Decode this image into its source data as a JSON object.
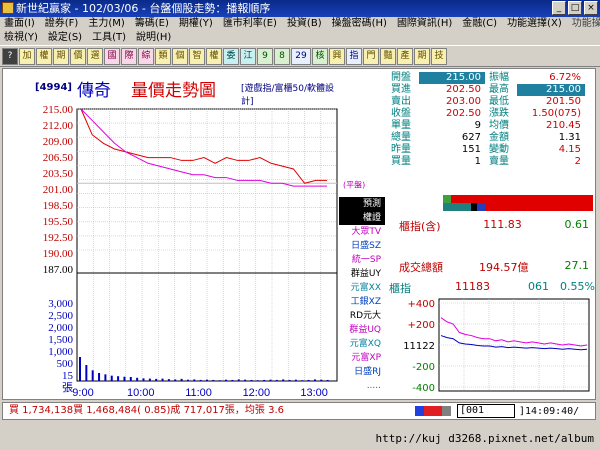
{
  "window": {
    "title": "新世紀贏家 - 102/03/06 - 台盤個股走勢：播報順序"
  },
  "menu_row1": [
    "畫面(I)",
    "證券(F)",
    "主力(M)",
    "籌碼(E)",
    "期權(Y)",
    "匯市利率(E)",
    "投資(B)",
    "操盤密碼(H)",
    "國際資訊(H)",
    "金融(C)",
    "功能選擇(X)"
  ],
  "menu_row1_right": "功能操作",
  "menu_row2": [
    "檢視(Y)",
    "設定(S)",
    "工具(T)",
    "說明(H)"
  ],
  "toolbar": [
    "?",
    "加",
    "權",
    "期",
    "價",
    "選",
    "國",
    "際",
    "綜",
    "類",
    "個",
    "智",
    "權",
    "委",
    "江",
    "9",
    "8",
    "29",
    "核",
    "興",
    "指",
    "門",
    "豔",
    "產",
    "期",
    "技"
  ],
  "header": {
    "code": "[4994]",
    "name": "傳奇",
    "title": "量價走勢圖",
    "setting": "[遊戲指/富櫃50/軟體設計]"
  },
  "side_labels": [
    "預測",
    "權證",
    "大眾TV",
    "日盛SZ",
    "統一SP",
    "群益UY",
    "元富XX",
    "工銀XZ",
    "RD元大",
    "群益UQ",
    "元富XQ",
    "元富XP",
    "日盛RJ",
    "....."
  ],
  "price_labels": [
    "215.00",
    "212.00",
    "209.00",
    "206.50",
    "203.50",
    "201.00",
    "198.50",
    "195.50",
    "192.50",
    "190.00",
    "187.00"
  ],
  "volume_labels": [
    "3,000",
    "2,500",
    "2,000",
    "1,500",
    "1,000",
    "500",
    "15",
    "張"
  ],
  "time_labels": [
    "9:00",
    "10:00",
    "11:00",
    "12:00",
    "13:00"
  ],
  "ref_label": "(平盤)",
  "quotes": [
    {
      "l1": "開盤",
      "v1": "215.00",
      "l2": "振幅",
      "v2": "6.72%"
    },
    {
      "l1": "買進",
      "v1": "202.50",
      "l2": "最高",
      "v2": "215.00"
    },
    {
      "l1": "賣出",
      "v1": "203.00",
      "l2": "最低",
      "v2": "201.50"
    },
    {
      "l1": "收盤",
      "v1": "202.50",
      "l2": "漲跌",
      "v2": "1.50(075)"
    },
    {
      "l1": "單量",
      "v1": "9",
      "l2": "均價",
      "v2": "210.45"
    },
    {
      "l1": "總量",
      "v1": "627",
      "l2": "金額",
      "v2": "1.31"
    },
    {
      "l1": "昨量",
      "v1": "151",
      "l2": "變動",
      "v2": "4.15"
    },
    {
      "l1": "買量",
      "v1": "1",
      "l2": "賣量",
      "v2": "2"
    }
  ],
  "index_line": {
    "label": "櫃指(含)",
    "v1": "111.83",
    "v2": "0.61"
  },
  "total_line": {
    "label": "成交總額",
    "v1": "194.57億",
    "v2": "27.1"
  },
  "otc_head": {
    "label": "櫃指",
    "v1": "11183",
    "v2": "061",
    "v3": "0.55%"
  },
  "mini_labels": [
    "+400",
    "+200",
    "11122",
    "-200",
    "-400"
  ],
  "status": {
    "text": "買 1,734,138買 1,468,484( 0.85)成 717,017張，均張 3.6",
    "code": "[001",
    "time": "]14:09:40/"
  },
  "url": "http://kuj d3268.pixnet.net/album",
  "chart_data": {
    "type": "line",
    "price": {
      "ylim": [
        187.0,
        215.0
      ],
      "reference": 202.0,
      "x": [
        "9:00",
        "9:05",
        "9:10",
        "9:15",
        "9:20",
        "9:30",
        "9:45",
        "10:00",
        "10:15",
        "10:30",
        "10:45",
        "11:00",
        "11:15",
        "11:30",
        "11:45",
        "12:00",
        "12:15",
        "12:30",
        "12:45",
        "13:00",
        "13:10",
        "13:20",
        "13:30"
      ],
      "series": [
        {
          "values": [
            215.0,
            210.5,
            209.0,
            208.0,
            207.5,
            207.0,
            206.5,
            206.5,
            206.5,
            206.0,
            206.0,
            206.5,
            205.5,
            206.5,
            206.0,
            206.0,
            206.5,
            205.5,
            205.0,
            204.5,
            202.0,
            202.5,
            202.5
          ]
        },
        {
          "values": [
            215.0,
            213.0,
            211.0,
            209.0,
            207.5,
            206.5,
            205.5,
            205.0,
            204.5,
            204.0,
            203.5,
            203.5,
            203.0,
            203.0,
            202.5,
            202.5,
            202.5,
            202.0,
            202.0,
            201.5,
            201.5,
            201.5,
            201.5
          ]
        }
      ]
    },
    "volume": {
      "ylim": [
        0,
        3000
      ],
      "values": [
        900,
        600,
        400,
        300,
        250,
        200,
        180,
        160,
        150,
        120,
        100,
        90,
        80,
        90,
        70,
        60,
        80,
        50,
        60,
        40,
        50,
        40,
        30,
        50,
        40,
        60,
        50,
        40,
        30,
        40,
        50,
        40,
        60,
        40,
        50,
        30,
        40,
        60,
        50,
        40
      ]
    },
    "otc_index": {
      "ylim": [
        -400,
        400
      ],
      "values": [
        260,
        220,
        200,
        120,
        100,
        90,
        70,
        60,
        60,
        40,
        50,
        30,
        40,
        30,
        20,
        30,
        20,
        10,
        20,
        10,
        0,
        10,
        0,
        -10,
        0
      ]
    }
  }
}
